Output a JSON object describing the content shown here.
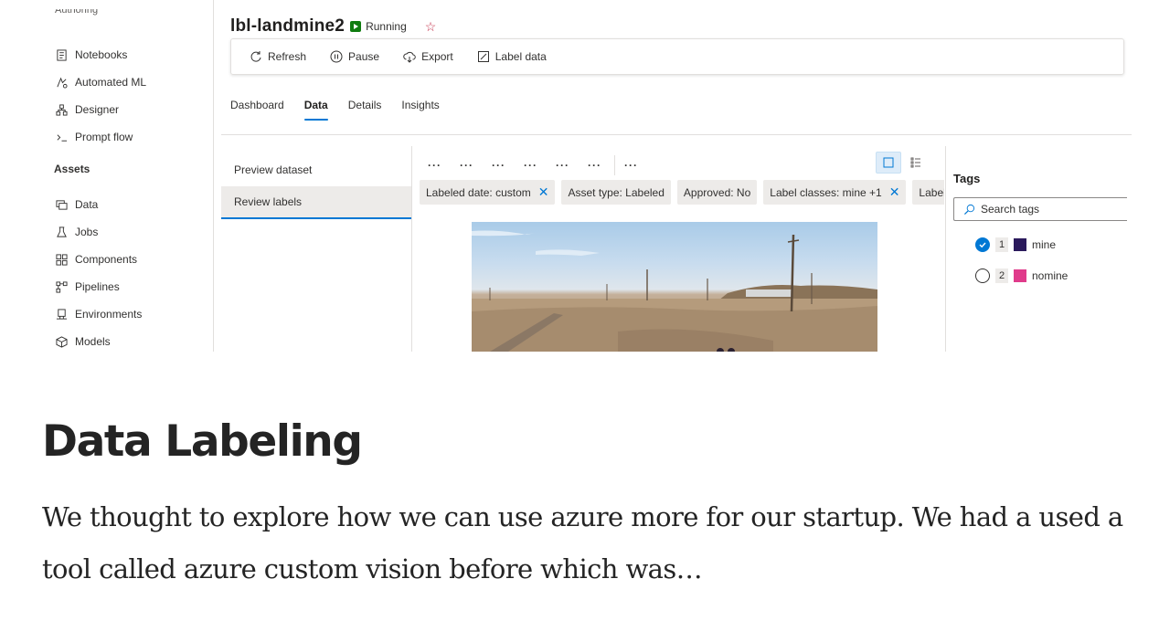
{
  "screenshot": {
    "sidebar": {
      "cutoff_label": "Authoring",
      "items": [
        {
          "label": "Notebooks",
          "icon": "notebook-icon"
        },
        {
          "label": "Automated ML",
          "icon": "automl-icon"
        },
        {
          "label": "Designer",
          "icon": "designer-icon"
        },
        {
          "label": "Prompt flow",
          "icon": "prompt-flow-icon"
        }
      ],
      "assets_heading": "Assets",
      "asset_items": [
        {
          "label": "Data",
          "icon": "data-icon"
        },
        {
          "label": "Jobs",
          "icon": "jobs-icon"
        },
        {
          "label": "Components",
          "icon": "components-icon"
        },
        {
          "label": "Pipelines",
          "icon": "pipelines-icon"
        },
        {
          "label": "Environments",
          "icon": "environments-icon"
        },
        {
          "label": "Models",
          "icon": "models-icon"
        }
      ]
    },
    "header": {
      "title": "lbl-landmine2",
      "status": "Running",
      "status_color": "#107c10",
      "favorite_icon": "star-icon"
    },
    "commands": {
      "refresh": "Refresh",
      "pause": "Pause",
      "export": "Export",
      "label_data": "Label data"
    },
    "tabs": [
      "Dashboard",
      "Data",
      "Details",
      "Insights"
    ],
    "active_tab": "Data",
    "left_panel": {
      "preview": "Preview dataset",
      "review": "Review labels"
    },
    "toolbar": {
      "dots": "···"
    },
    "filters": [
      {
        "label": "Labeled date: custom",
        "removable": true
      },
      {
        "label": "Asset type: Labeled",
        "removable": false
      },
      {
        "label": "Approved: No",
        "removable": false
      },
      {
        "label": "Label classes: mine +1",
        "removable": true
      },
      {
        "label": "Labelers:",
        "removable": false
      }
    ],
    "tags": {
      "title": "Tags",
      "search_placeholder": "Search tags",
      "items": [
        {
          "key": "1",
          "name": "mine",
          "color": "#2b1a5c",
          "selected": true
        },
        {
          "key": "2",
          "name": "nomine",
          "color": "#e03b8b",
          "selected": false
        }
      ]
    },
    "accent_color": "#0078d4"
  },
  "article": {
    "title": "Data Labeling",
    "body": "We thought to explore how we can use azure more for our startup. We had a used a tool called azure custom vision before which was…"
  }
}
